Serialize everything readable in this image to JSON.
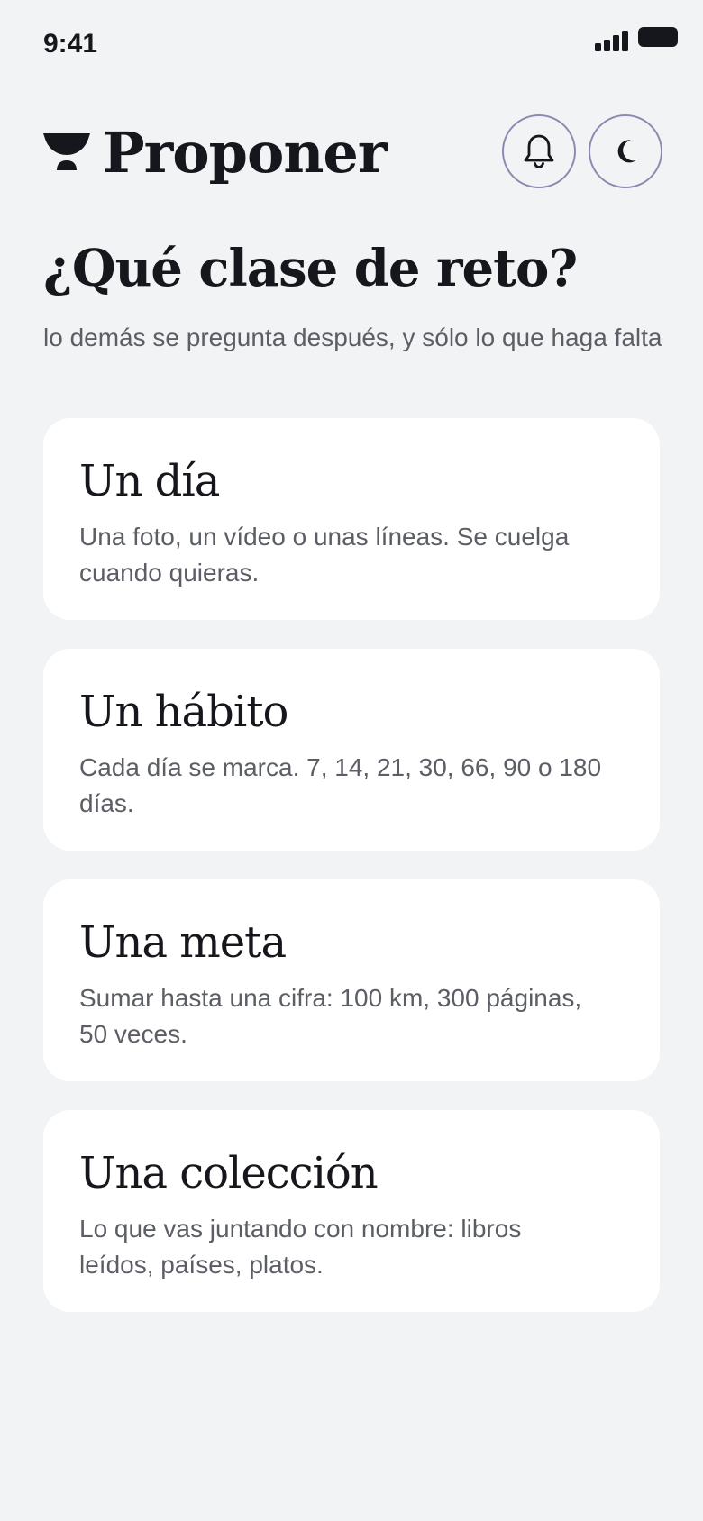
{
  "status_bar": {
    "time": "9:41"
  },
  "header": {
    "title": "Proponer",
    "logo_icon": "goblet-icon",
    "notifications_icon": "bell-icon",
    "theme_icon": "moon-icon"
  },
  "main": {
    "heading": "¿Qué clase de reto?",
    "subheading": "lo demás se pregunta después, y sólo lo que haga falta",
    "options": [
      {
        "title": "Un día",
        "description": "Una foto, un vídeo o unas líneas. Se cuelga cuando quieras."
      },
      {
        "title": "Un hábito",
        "description": "Cada día se marca. 7, 14, 21, 30, 66, 90 o 180 días."
      },
      {
        "title": "Una meta",
        "description": "Sumar hasta una cifra: 100 km, 300 páginas, 50 veces."
      },
      {
        "title": "Una colección",
        "description": "Lo que vas juntando con nombre: libros leídos, países, platos."
      }
    ]
  },
  "colors": {
    "background": "#f2f3f5",
    "card": "#ffffff",
    "text_primary": "#16171c",
    "text_secondary": "#5c5e66",
    "button_border": "#8f89b2"
  }
}
